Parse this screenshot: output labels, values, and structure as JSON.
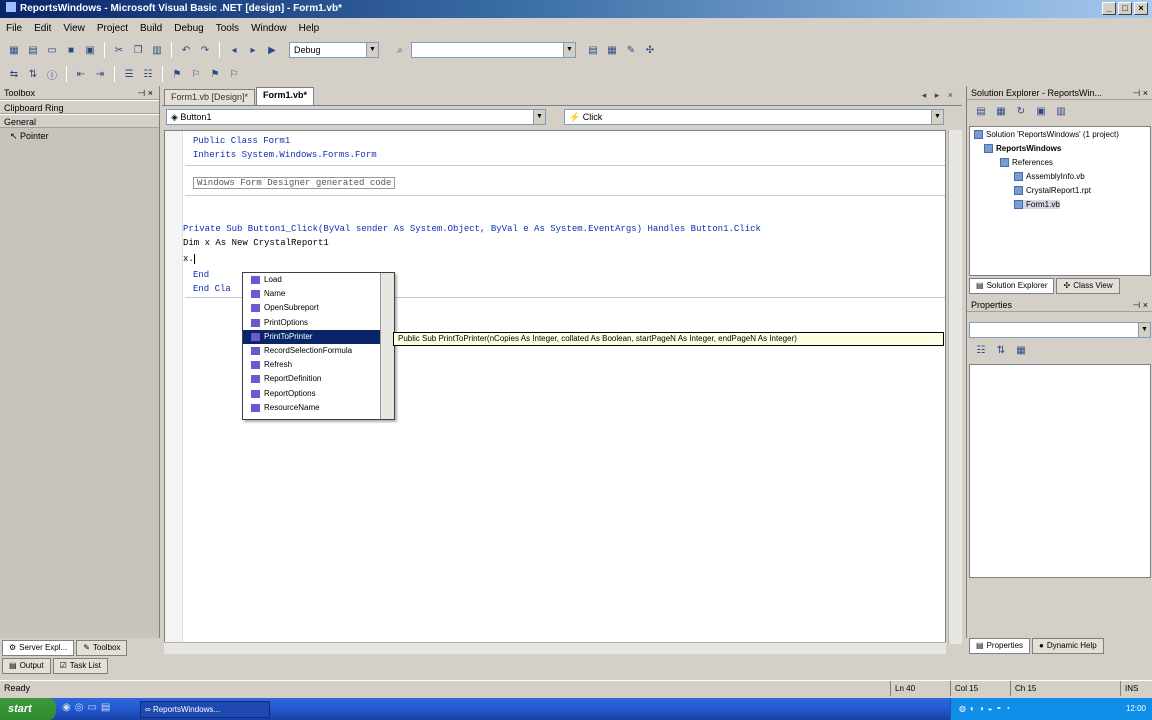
{
  "window": {
    "title": "ReportsWindows - Microsoft Visual Basic .NET [design] - Form1.vb*",
    "buttons": [
      "_",
      "□",
      "×"
    ]
  },
  "menu": [
    "File",
    "Edit",
    "View",
    "Project",
    "Build",
    "Debug",
    "Tools",
    "Window",
    "Help"
  ],
  "toolbar": {
    "config_combo": "Debug",
    "find_combo": ""
  },
  "toolbox": {
    "title": "Toolbox",
    "sections": [
      "Clipboard Ring",
      "General"
    ],
    "items": [
      "Pointer"
    ]
  },
  "editor": {
    "tabs": [
      "Form1.vb [Design]*",
      "Form1.vb*"
    ],
    "tab_controls": "◂ ▸ ×",
    "class_combo": "Button1",
    "method_combo": "Click",
    "code_lines": [
      "Public Class Form1",
      "    Inherits System.Windows.Forms.Form",
      "Windows Form Designer generated code",
      "    Private Sub Button1_Click(ByVal sender As System.Object, ByVal e As System.EventArgs) Handles Button1.Click",
      "        Dim x As New CrystalReport1",
      "        x.",
      "    End",
      "End Cla"
    ]
  },
  "intellisense": {
    "items": [
      "Load",
      "Name",
      "OpenSubreport",
      "PrintOptions",
      "PrintToPrinter",
      "RecordSelectionFormula",
      "Refresh",
      "ReportDefinition",
      "ReportOptions",
      "ResourceName"
    ],
    "selected_index": 4,
    "tooltip": "Public Sub PrintToPrinter(nCopies As Integer, collated As Boolean, startPageN As Integer, endPageN As Integer)"
  },
  "solution_explorer": {
    "title": "Solution Explorer - ReportsWin...",
    "nodes": [
      "Solution 'ReportsWindows' (1 project)",
      "ReportsWindows",
      "References",
      "AssemblyInfo.vb",
      "CrystalReport1.rpt",
      "Form1.vb"
    ],
    "tabs": [
      "Solution Explorer",
      "Class View"
    ]
  },
  "properties": {
    "title": "Properties",
    "tabs": [
      "Properties",
      "Dynamic Help"
    ]
  },
  "bottom_tabs": [
    "Server Expl...",
    "Toolbox",
    "Output",
    "Task List"
  ],
  "status": {
    "text": "Ready",
    "ln": "Ln 40",
    "col": "Col 15",
    "ch": "Ch 15",
    "mode": "INS"
  },
  "taskbar": {
    "start": "start",
    "item": "ReportsWindows...",
    "clock": "12:00"
  }
}
